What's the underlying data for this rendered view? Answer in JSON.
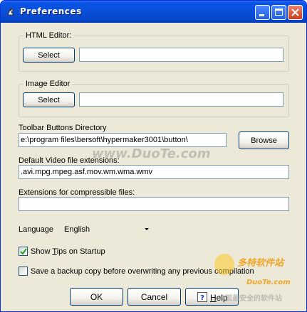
{
  "window": {
    "title": "Preferences",
    "controls": {
      "minimize": "minimize",
      "maximize": "maximize",
      "close": "close"
    }
  },
  "html_editor": {
    "label": "HTML Editor:",
    "select_label": "Select",
    "value": ""
  },
  "image_editor": {
    "label": "Image Editor",
    "select_label": "Select",
    "value": ""
  },
  "toolbar_dir": {
    "label": "Toolbar Buttons Directory",
    "value": "e:\\program files\\bersoft\\hypermaker3001\\button\\",
    "browse_label": "Browse"
  },
  "video_ext": {
    "label": "Default Video file extensions:",
    "value": ".avi.mpg.mpeg.asf.mov.wm.wma.wmv"
  },
  "compress_ext": {
    "label": "Extensions for compressible files:",
    "value": ""
  },
  "language": {
    "label": "Language",
    "selected": "English"
  },
  "show_tips": {
    "label_pre": "Show ",
    "label_key": "T",
    "label_post": "ips on Startup",
    "checked": true
  },
  "backup": {
    "label": "Save a backup copy before overwriting any previous compilation",
    "checked": false
  },
  "buttons": {
    "ok": "OK",
    "cancel": "Cancel",
    "help_key": "H",
    "help_rest": "elp"
  },
  "watermarks": {
    "center": "www.DuoTe.com",
    "bottom_cn": "多特软件站",
    "bottom_url": "DuoTe.com",
    "bottom_slogan": "中国最安全的软件站"
  },
  "colors": {
    "title_bar": "#0a4fd8",
    "face": "#ece9d8",
    "field_border": "#7f9db9"
  }
}
